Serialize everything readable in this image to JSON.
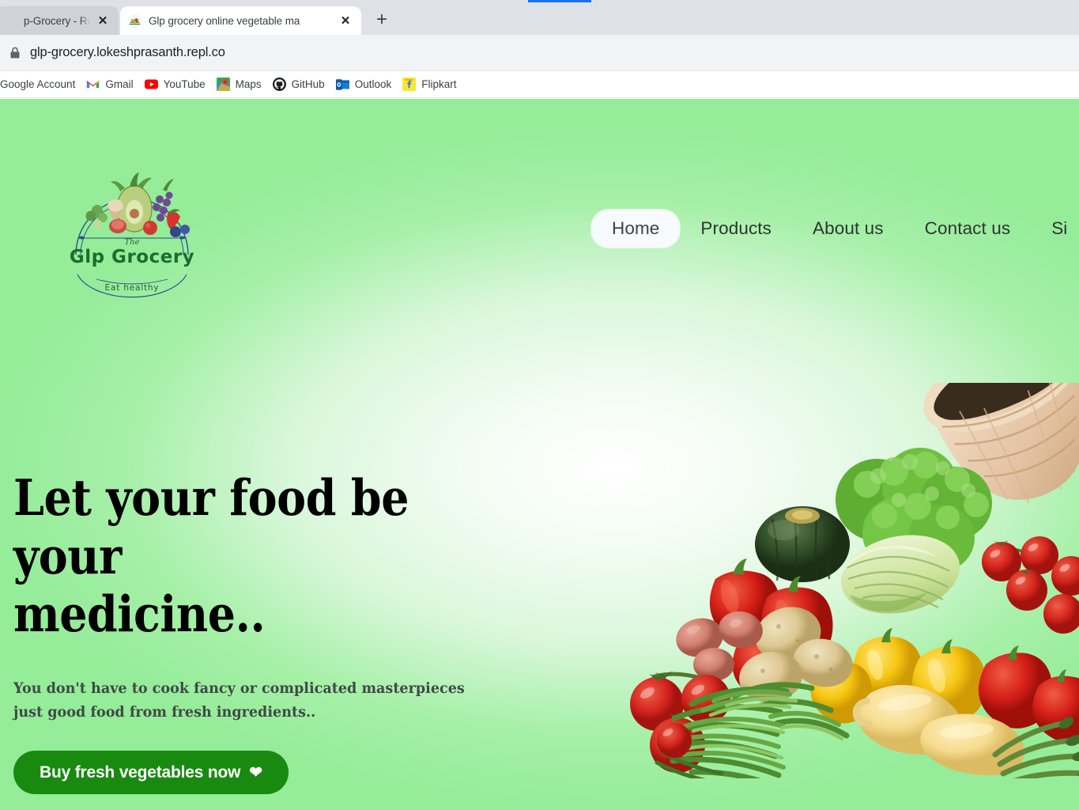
{
  "browser": {
    "tabs": [
      {
        "title": "p-Grocery - Replit",
        "active": false,
        "favicon": "replit-icon",
        "close_label": "✕"
      },
      {
        "title": "Glp grocery online vegetable ma",
        "active": true,
        "favicon": "glp-grocery-icon",
        "close_label": "✕"
      }
    ],
    "new_tab_label": "+",
    "address_bar": {
      "url": "glp-grocery.lokeshprasanth.repl.co",
      "security_icon": "lock-icon"
    },
    "bookmarks": [
      {
        "label": "Google Account",
        "icon": "google-account-icon"
      },
      {
        "label": "Gmail",
        "icon": "gmail-icon"
      },
      {
        "label": "YouTube",
        "icon": "youtube-icon"
      },
      {
        "label": "Maps",
        "icon": "google-maps-icon"
      },
      {
        "label": "GitHub",
        "icon": "github-icon"
      },
      {
        "label": "Outlook",
        "icon": "outlook-icon"
      },
      {
        "label": "Flipkart",
        "icon": "flipkart-icon"
      }
    ]
  },
  "site": {
    "logo": {
      "brand": "Glp Grocery",
      "prefix": "The",
      "tagline": "Eat healthy",
      "alt": "glp-grocery-logo"
    },
    "nav": [
      {
        "label": "Home",
        "active": true
      },
      {
        "label": "Products",
        "active": false
      },
      {
        "label": "About us",
        "active": false
      },
      {
        "label": "Contact us",
        "active": false
      },
      {
        "label": "Si",
        "active": false
      }
    ],
    "hero": {
      "title": "Let your food be your\nmedicine..",
      "subtitle": "You don't have to cook fancy or complicated masterpieces\njust good food from fresh ingredients..",
      "cta_label": "Buy fresh vegetables now",
      "cta_icon": "heart-icon",
      "art_alt": "vegetable-basket-image"
    }
  },
  "colors": {
    "bg_green": "#95ec99",
    "bg_center": "#ffffff",
    "cta_green": "#188a10",
    "nav_text": "#2c3531",
    "logo_green": "#1d6b2e",
    "chrome_tabstrip": "#dee1e6",
    "chrome_omnibar": "#f1f3f4"
  }
}
